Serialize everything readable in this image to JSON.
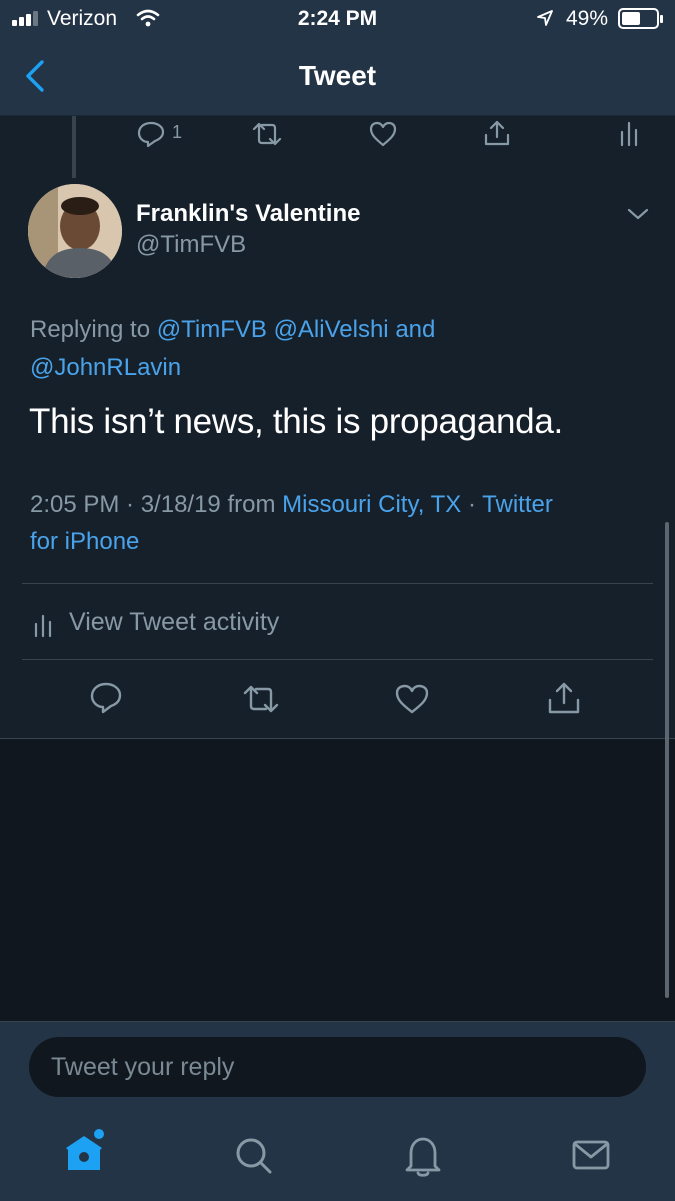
{
  "status_bar": {
    "carrier": "Verizon",
    "time": "2:24 PM",
    "battery": "49%"
  },
  "header": {
    "title": "Tweet"
  },
  "prev_tweet_actions": {
    "reply_count": "1"
  },
  "tweet": {
    "display_name": "Franklin's Valentine",
    "handle": "@TimFVB",
    "replying_prefix": "Replying to",
    "replying_to": [
      "@TimFVB",
      "@AliVelshi"
    ],
    "replying_and": "and",
    "replying_last": "@JohnRLavin",
    "text": "This isn’t news, this is propaganda.",
    "timestamp": "2:05 PM · 3/18/19 from",
    "location": "Missouri City, TX",
    "separator": "·",
    "source_line1": "Twitter",
    "source_line2": "for iPhone",
    "activity_label": "View Tweet activity"
  },
  "reply": {
    "placeholder": "Tweet your reply"
  },
  "colors": {
    "accent": "#1da1f2",
    "link": "#4aa3ea",
    "muted": "#8899a6",
    "background": "#15202b"
  }
}
